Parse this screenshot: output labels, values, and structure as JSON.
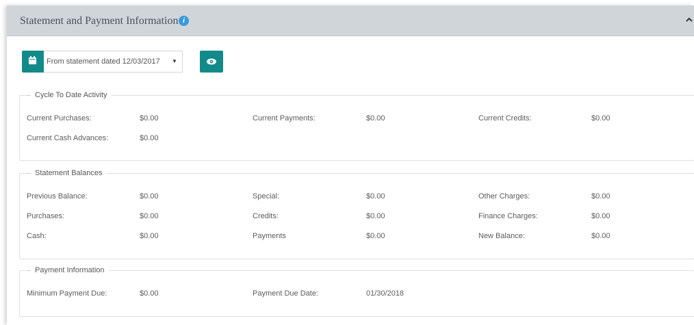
{
  "header": {
    "title": "Statement and Payment Information",
    "info_icon": "info-icon",
    "info_icon_glyph": "i",
    "collapse_icon": "chevron-up-icon"
  },
  "toolbar": {
    "calendar_icon": "calendar-icon",
    "statement_select": {
      "selected": "From statement dated 12/03/2017",
      "caret": "▼"
    },
    "view_button_icon": "eye-icon"
  },
  "colors": {
    "accent": "#138a8a",
    "header_bg": "#cfd5d9",
    "info": "#3a9ad9"
  },
  "cycle_to_date": {
    "legend": "Cycle To Date Activity",
    "rows": [
      [
        {
          "label": "Current Purchases:",
          "value": "$0.00"
        },
        {
          "label": "Current Payments:",
          "value": "$0.00"
        },
        {
          "label": "Current Credits:",
          "value": "$0.00"
        }
      ],
      [
        {
          "label": "Current Cash Advances:",
          "value": "$0.00"
        }
      ]
    ]
  },
  "statement_balances": {
    "legend": "Statement Balances",
    "rows": [
      [
        {
          "label": "Previous Balance:",
          "value": "$0.00"
        },
        {
          "label": "Special:",
          "value": "$0.00"
        },
        {
          "label": "Other Charges:",
          "value": "$0.00"
        }
      ],
      [
        {
          "label": "Purchases:",
          "value": "$0.00"
        },
        {
          "label": "Credits:",
          "value": "$0.00"
        },
        {
          "label": "Finance Charges:",
          "value": "$0.00"
        }
      ],
      [
        {
          "label": "Cash:",
          "value": "$0.00"
        },
        {
          "label": "Payments",
          "value": "$0.00"
        },
        {
          "label": "New Balance:",
          "value": "$0.00"
        }
      ]
    ]
  },
  "payment_information": {
    "legend": "Payment Information",
    "rows": [
      [
        {
          "label": "Minimum Payment Due:",
          "value": "$0.00"
        },
        {
          "label": "Payment Due Date:",
          "value": "01/30/2018"
        }
      ]
    ]
  }
}
